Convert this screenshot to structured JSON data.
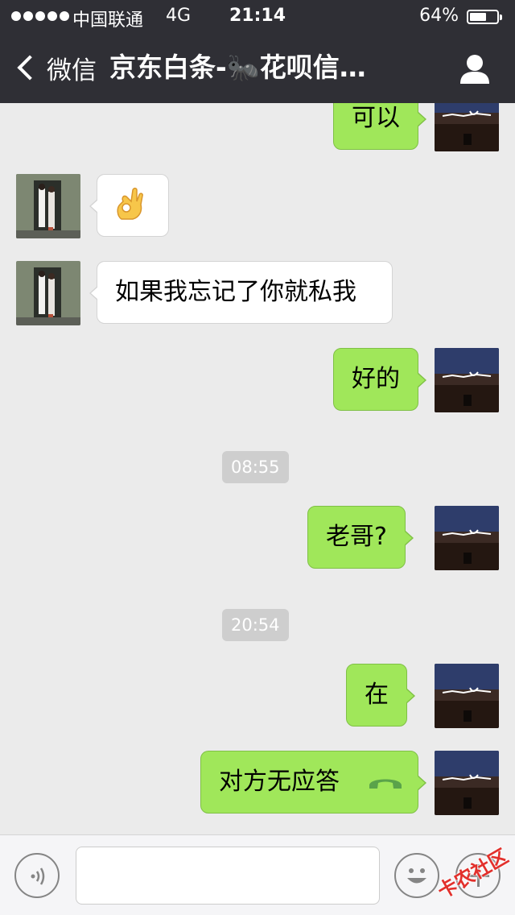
{
  "status_bar": {
    "carrier": "中国联通",
    "network": "4G",
    "time": "21:14",
    "battery_percent": "64%",
    "battery_level": 0.64
  },
  "nav": {
    "back_label": "微信",
    "title": "京东白条-🐜花呗信…",
    "profile_icon": "person-icon"
  },
  "messages": [
    {
      "side": "right",
      "text": "可以"
    },
    {
      "side": "left",
      "text": "👌",
      "type": "emoji"
    },
    {
      "side": "left",
      "text": "如果我忘记了你就私我"
    },
    {
      "side": "right",
      "text": "好的"
    },
    {
      "side": "time",
      "text": "08:55"
    },
    {
      "side": "right",
      "text": "老哥?"
    },
    {
      "side": "time",
      "text": "20:54"
    },
    {
      "side": "right",
      "text": "在"
    },
    {
      "side": "right",
      "text": "对方无应答",
      "type": "call",
      "icon": "phone-hangup-icon"
    }
  ],
  "input_bar": {
    "placeholder": "",
    "voice_icon": "voice-icon",
    "emoji_icon": "smiley-icon",
    "plus_icon": "plus-icon"
  },
  "watermark": "卡农社区",
  "colors": {
    "nav_bg": "#2f2f35",
    "chat_bg": "#ebebeb",
    "outgoing_bubble": "#a0e75a",
    "incoming_bubble": "#ffffff",
    "timestamp_bg": "#cecece",
    "call_icon": "#5aa34a"
  }
}
